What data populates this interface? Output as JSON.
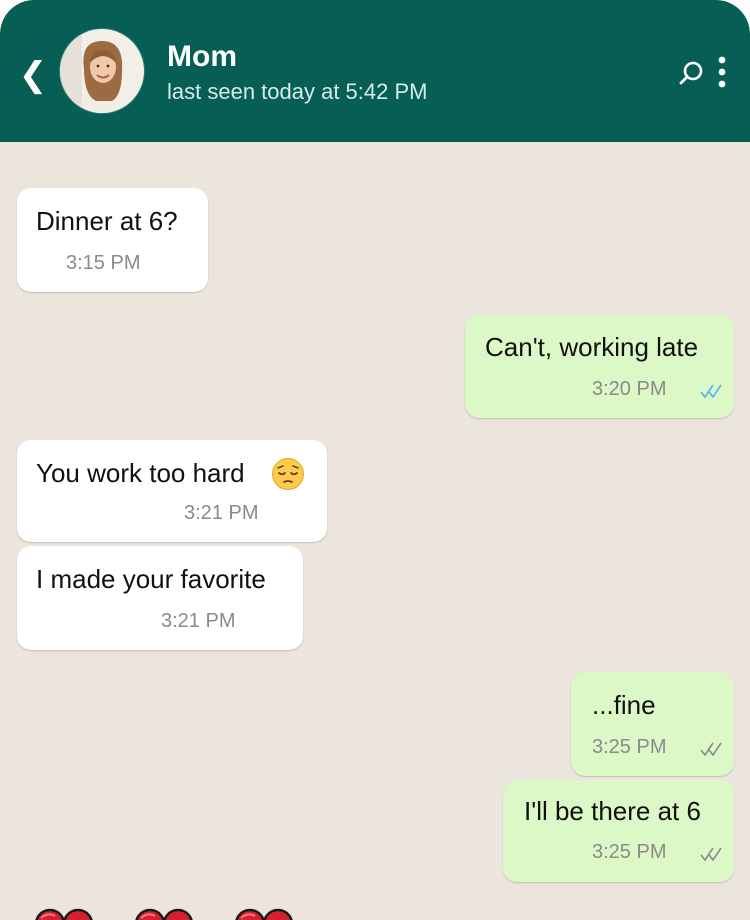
{
  "header": {
    "contact_name": "Mom",
    "status": "last seen today at 5:42 PM",
    "icons": {
      "back": "back-chevron-icon",
      "avatar": "contact-avatar",
      "search": "search-icon",
      "more": "more-options-icon"
    }
  },
  "messages": [
    {
      "direction": "incoming",
      "text": "Dinner at 6?",
      "time": "3:15 PM"
    },
    {
      "direction": "outgoing",
      "text": "Can't, working late",
      "time": "3:20 PM",
      "receipt": "read"
    },
    {
      "direction": "incoming",
      "text": "You work too hard",
      "emoji": "pensive-face",
      "time": "3:21 PM"
    },
    {
      "direction": "incoming",
      "text": "I made your favorite",
      "time": "3:21 PM"
    },
    {
      "direction": "outgoing",
      "text": "...fine",
      "time": "3:25 PM",
      "receipt": "delivered"
    },
    {
      "direction": "outgoing",
      "text": "I'll be there at 6",
      "time": "3:25 PM",
      "receipt": "delivered"
    }
  ],
  "footer_emoji": [
    "red-heart",
    "red-heart",
    "red-heart"
  ],
  "colors": {
    "header": "#075e54",
    "chat_background": "#ece5dd",
    "incoming_bubble": "#ffffff",
    "outgoing_bubble": "#dcf8c6",
    "read_ticks": "#4fb6ec",
    "delivered_ticks": "#8a8a8a"
  }
}
